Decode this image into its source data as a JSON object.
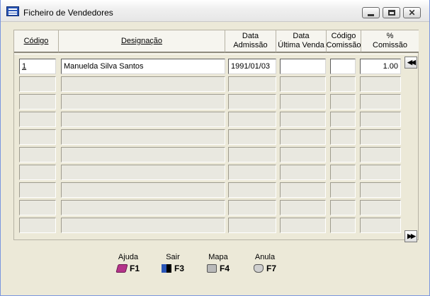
{
  "window": {
    "title": "Ficheiro de Vendedores"
  },
  "grid": {
    "columns": [
      {
        "label": "Código",
        "label2": ""
      },
      {
        "label": "Designação",
        "label2": ""
      },
      {
        "label": "Data",
        "label2": "Admissão"
      },
      {
        "label": "Data",
        "label2": "Última Venda"
      },
      {
        "label": "Código",
        "label2": "Comissão"
      },
      {
        "label": "%",
        "label2": "Comissão"
      }
    ],
    "rows": [
      {
        "codigo": "1",
        "designacao": "Manuelda Silva Santos",
        "data_admissao": "1991/01/03",
        "data_ultima_venda": "",
        "codigo_comissao": "",
        "pct_comissao": "1.00"
      },
      {
        "codigo": "",
        "designacao": "",
        "data_admissao": "",
        "data_ultima_venda": "",
        "codigo_comissao": "",
        "pct_comissao": ""
      },
      {
        "codigo": "",
        "designacao": "",
        "data_admissao": "",
        "data_ultima_venda": "",
        "codigo_comissao": "",
        "pct_comissao": ""
      },
      {
        "codigo": "",
        "designacao": "",
        "data_admissao": "",
        "data_ultima_venda": "",
        "codigo_comissao": "",
        "pct_comissao": ""
      },
      {
        "codigo": "",
        "designacao": "",
        "data_admissao": "",
        "data_ultima_venda": "",
        "codigo_comissao": "",
        "pct_comissao": ""
      },
      {
        "codigo": "",
        "designacao": "",
        "data_admissao": "",
        "data_ultima_venda": "",
        "codigo_comissao": "",
        "pct_comissao": ""
      },
      {
        "codigo": "",
        "designacao": "",
        "data_admissao": "",
        "data_ultima_venda": "",
        "codigo_comissao": "",
        "pct_comissao": ""
      },
      {
        "codigo": "",
        "designacao": "",
        "data_admissao": "",
        "data_ultima_venda": "",
        "codigo_comissao": "",
        "pct_comissao": ""
      },
      {
        "codigo": "",
        "designacao": "",
        "data_admissao": "",
        "data_ultima_venda": "",
        "codigo_comissao": "",
        "pct_comissao": ""
      },
      {
        "codigo": "",
        "designacao": "",
        "data_admissao": "",
        "data_ultima_venda": "",
        "codigo_comissao": "",
        "pct_comissao": ""
      }
    ],
    "nav": {
      "top_icon": "rewind-icon",
      "bottom_icon": "fast-forward-icon"
    }
  },
  "function_keys": [
    {
      "label": "Ajuda",
      "key": "F1",
      "icon": "book-icon"
    },
    {
      "label": "Sair",
      "key": "F3",
      "icon": "exit-door-icon"
    },
    {
      "label": "Mapa",
      "key": "F4",
      "icon": "printer-icon"
    },
    {
      "label": "Anula",
      "key": "F7",
      "icon": "trash-icon"
    }
  ],
  "colors": {
    "window_bg": "#ece9d8",
    "cell_bg": "#e9e8e0",
    "active_cell_bg": "#ffffff"
  }
}
